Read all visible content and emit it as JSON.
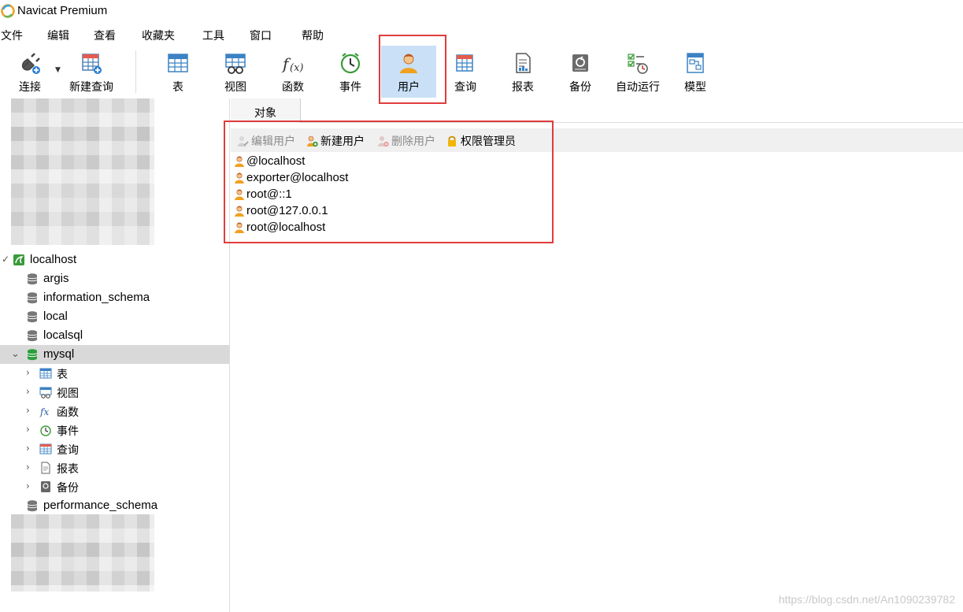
{
  "window": {
    "title": "Navicat Premium"
  },
  "menu": [
    "文件",
    "编辑",
    "查看",
    "收藏夹",
    "工具",
    "窗口",
    "帮助"
  ],
  "toolbar": {
    "connect": "连接",
    "new_query": "新建查询",
    "items": [
      "表",
      "视图",
      "函数",
      "事件",
      "用户",
      "查询",
      "报表",
      "备份",
      "自动运行",
      "模型"
    ],
    "active": "用户"
  },
  "sidebar": {
    "connection": "localhost",
    "databases": [
      "argis",
      "information_schema",
      "local",
      "localsql"
    ],
    "selected_db": "mysql",
    "db_children": [
      "表",
      "视图",
      "函数",
      "事件",
      "查询",
      "报表",
      "备份"
    ],
    "after": "performance_schema"
  },
  "main": {
    "tab": "对象",
    "actions": {
      "edit_user": "编辑用户",
      "new_user": "新建用户",
      "delete_user": "删除用户",
      "privilege_manager": "权限管理员"
    },
    "users": [
      "@localhost",
      "exporter@localhost",
      "root@::1",
      "root@127.0.0.1",
      "root@localhost"
    ]
  },
  "watermark": "https://blog.csdn.net/An1090239782",
  "colors": {
    "highlight_box": "#e03c3c",
    "active_tool": "#c9e0f7",
    "selected_row": "#d9d9d9"
  }
}
